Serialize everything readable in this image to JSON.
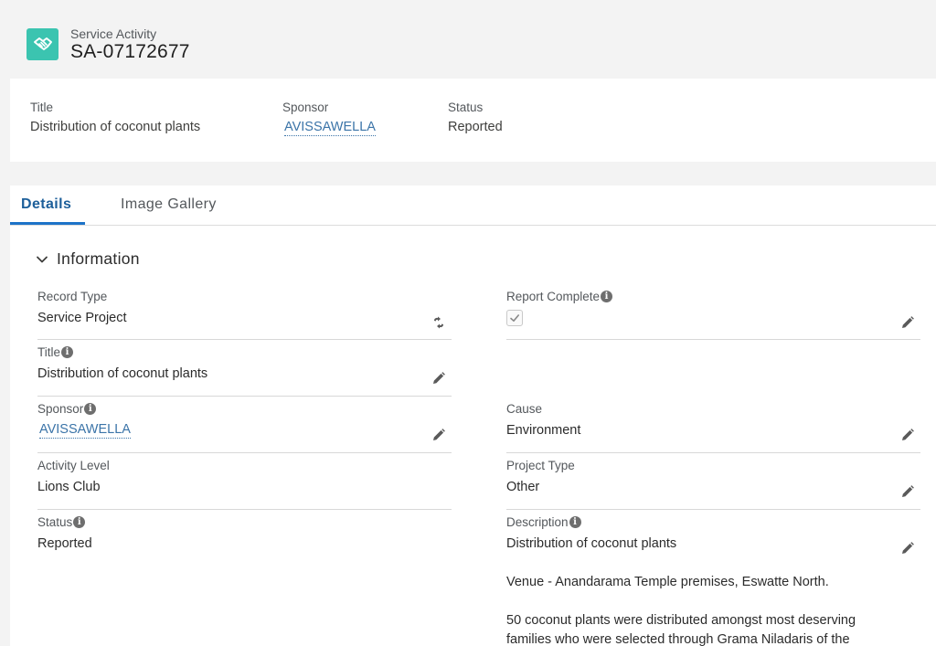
{
  "header": {
    "object_type": "Service Activity",
    "record_name": "SA-07172677",
    "icon": "handshake-icon"
  },
  "highlights": {
    "title_label": "Title",
    "title_value": "Distribution of coconut plants",
    "sponsor_label": "Sponsor",
    "sponsor_value": "AVISSAWELLA",
    "status_label": "Status",
    "status_value": "Reported"
  },
  "tabs": [
    {
      "label": "Details",
      "active": true
    },
    {
      "label": "Image Gallery",
      "active": false
    }
  ],
  "section": {
    "title": "Information"
  },
  "fields": {
    "record_type": {
      "label": "Record Type",
      "value": "Service Project"
    },
    "report_complete": {
      "label": "Report Complete",
      "checked": true
    },
    "title": {
      "label": "Title",
      "value": "Distribution of coconut plants"
    },
    "sponsor": {
      "label": "Sponsor",
      "value": "AVISSAWELLA"
    },
    "cause": {
      "label": "Cause",
      "value": "Environment"
    },
    "activity_level": {
      "label": "Activity Level",
      "value": "Lions Club"
    },
    "project_type": {
      "label": "Project Type",
      "value": "Other"
    },
    "status": {
      "label": "Status",
      "value": "Reported"
    },
    "description": {
      "label": "Description",
      "p1": "Distribution of coconut plants",
      "p2": "Venue - Anandarama Temple premises, Eswatte North.",
      "p3": "50 coconut plants were distributed amongst most deserving families who were selected through Grama Niladaris of the"
    }
  },
  "colors": {
    "accent": "#1d73c8",
    "link": "#3b74a8",
    "icon_bg": "#3bc4b0"
  }
}
